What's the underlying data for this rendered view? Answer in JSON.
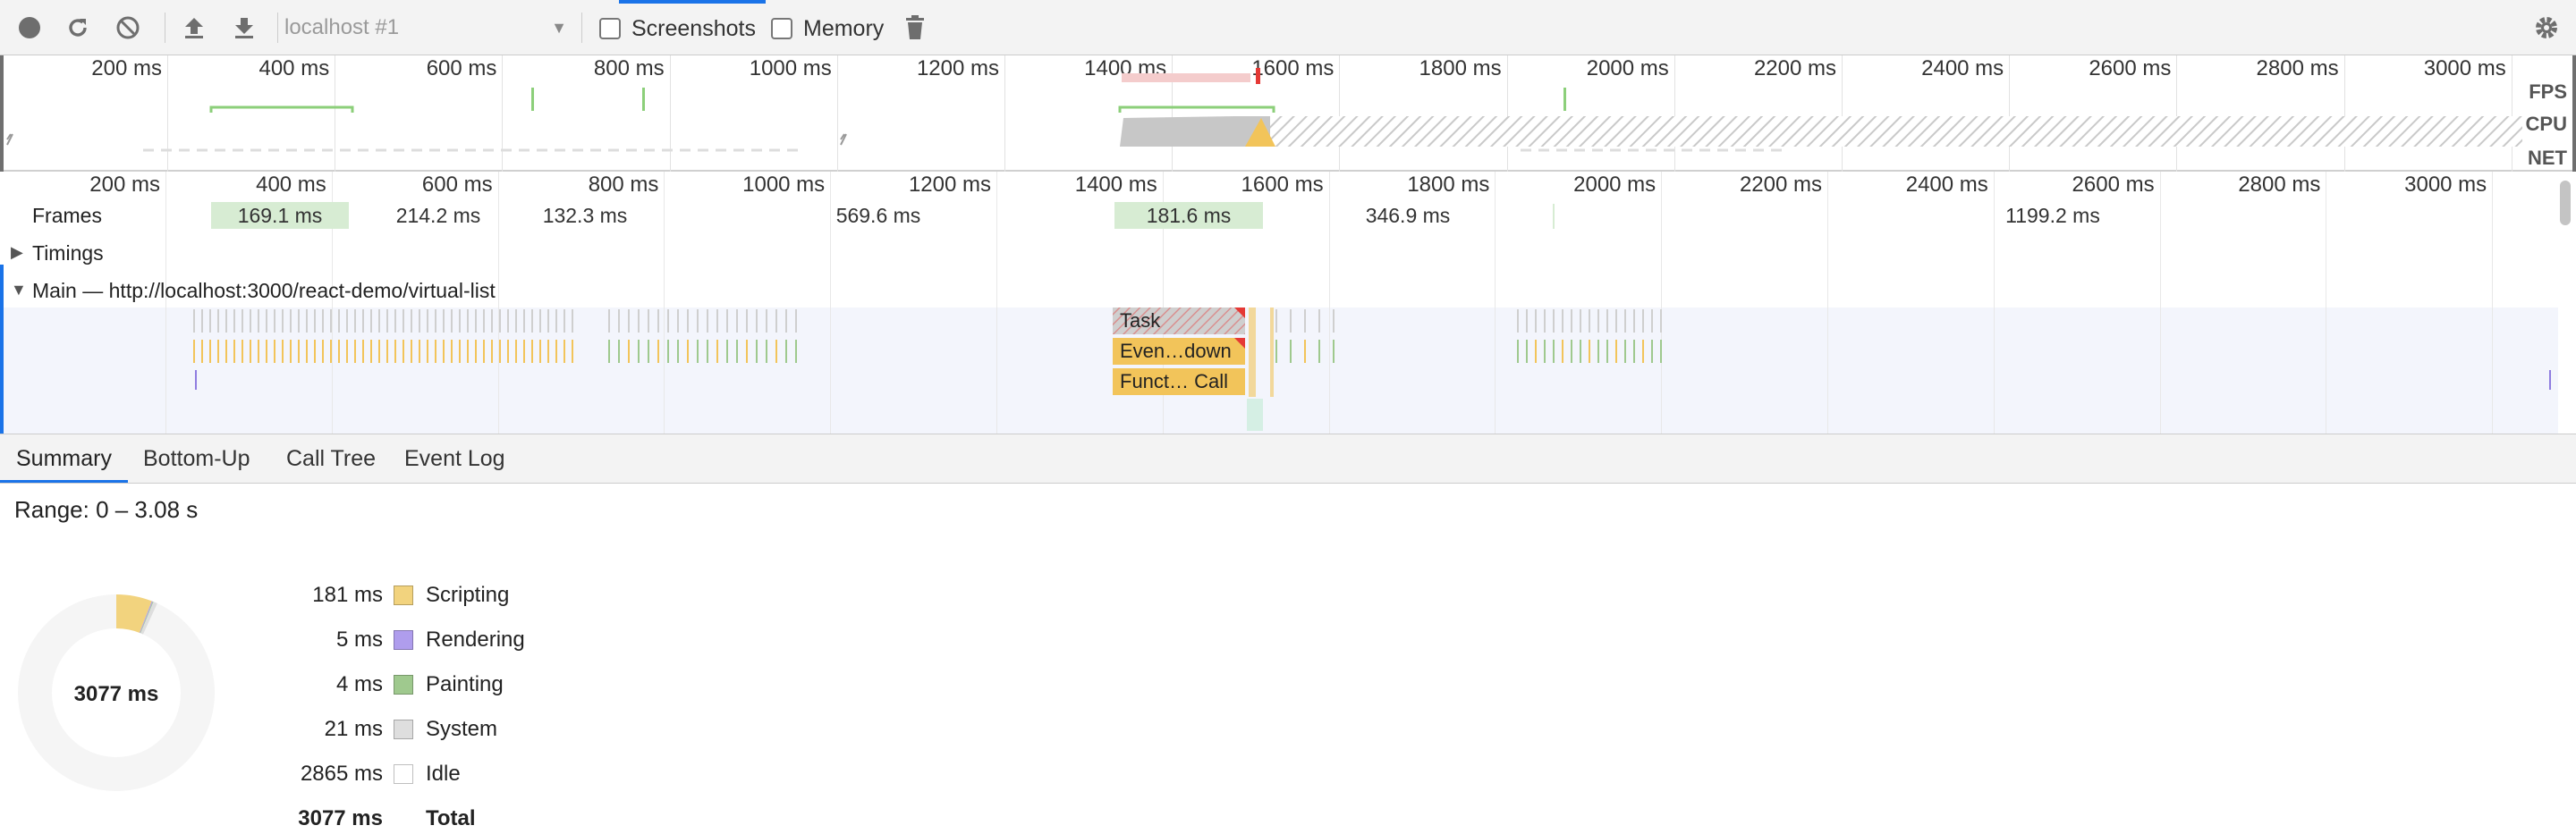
{
  "toolbar": {
    "profile_select": "localhost #1",
    "screenshots_label": "Screenshots",
    "memory_label": "Memory"
  },
  "overview": {
    "ticks": [
      "200 ms",
      "400 ms",
      "600 ms",
      "800 ms",
      "1000 ms",
      "1200 ms",
      "1400 ms",
      "1600 ms",
      "1800 ms",
      "2000 ms",
      "2200 ms",
      "2400 ms",
      "2600 ms",
      "2800 ms",
      "3000 ms"
    ],
    "tracks": [
      "FPS",
      "CPU",
      "NET"
    ]
  },
  "flame": {
    "ticks": [
      "200 ms",
      "400 ms",
      "600 ms",
      "800 ms",
      "1000 ms",
      "1200 ms",
      "1400 ms",
      "1600 ms",
      "1800 ms",
      "2000 ms",
      "2200 ms",
      "2400 ms",
      "2600 ms",
      "2800 ms",
      "3000 ms"
    ],
    "frames_label": "Frames",
    "frames": [
      "169.1 ms",
      "214.2 ms",
      "132.3 ms",
      "569.6 ms",
      "181.6 ms",
      "346.9 ms",
      "1199.2 ms"
    ],
    "timings_label": "Timings",
    "main_label": "Main — http://localhost:3000/react-demo/virtual-list",
    "blocks": [
      "Task",
      "Even…down",
      "Funct… Call"
    ]
  },
  "bottom_tabs": [
    "Summary",
    "Bottom-Up",
    "Call Tree",
    "Event Log"
  ],
  "summary": {
    "range": "Range: 0 – 3.08 s",
    "donut_total": "3077 ms",
    "legend": [
      {
        "value": "181 ms",
        "name": "Scripting",
        "color": "#f2d37e"
      },
      {
        "value": "5 ms",
        "name": "Rendering",
        "color": "#af9ded"
      },
      {
        "value": "4 ms",
        "name": "Painting",
        "color": "#9fc98e"
      },
      {
        "value": "21 ms",
        "name": "System",
        "color": "#dedede"
      },
      {
        "value": "2865 ms",
        "name": "Idle",
        "color": "#ffffff"
      }
    ],
    "total": {
      "value": "3077 ms",
      "name": "Total"
    }
  },
  "colors": {
    "accent": "#1a73e8",
    "scripting": "#f2d37e",
    "task": "#c8c8c8",
    "frame_green": "#d7ecd3"
  }
}
